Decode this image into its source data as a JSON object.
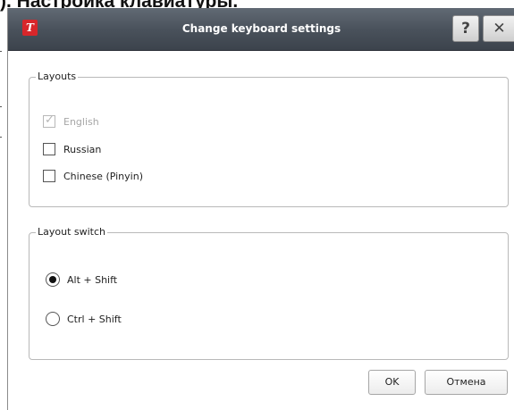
{
  "background": {
    "heading": "). Настройка клавиатуры."
  },
  "dialog": {
    "title": "Change keyboard settings",
    "logo_text": "T",
    "help_label": "?",
    "close_label": "✕"
  },
  "layouts": {
    "title": "Layouts",
    "items": [
      {
        "label": "English",
        "checked": true,
        "enabled": false
      },
      {
        "label": "Russian",
        "checked": false,
        "enabled": true
      },
      {
        "label": "Chinese (Pinyin)",
        "checked": false,
        "enabled": true
      }
    ]
  },
  "layout_switch": {
    "title": "Layout switch",
    "options": [
      {
        "label": "Alt + Shift",
        "selected": true
      },
      {
        "label": "Ctrl + Shift",
        "selected": false
      }
    ]
  },
  "buttons": {
    "ok": "OK",
    "cancel": "Отмена"
  }
}
